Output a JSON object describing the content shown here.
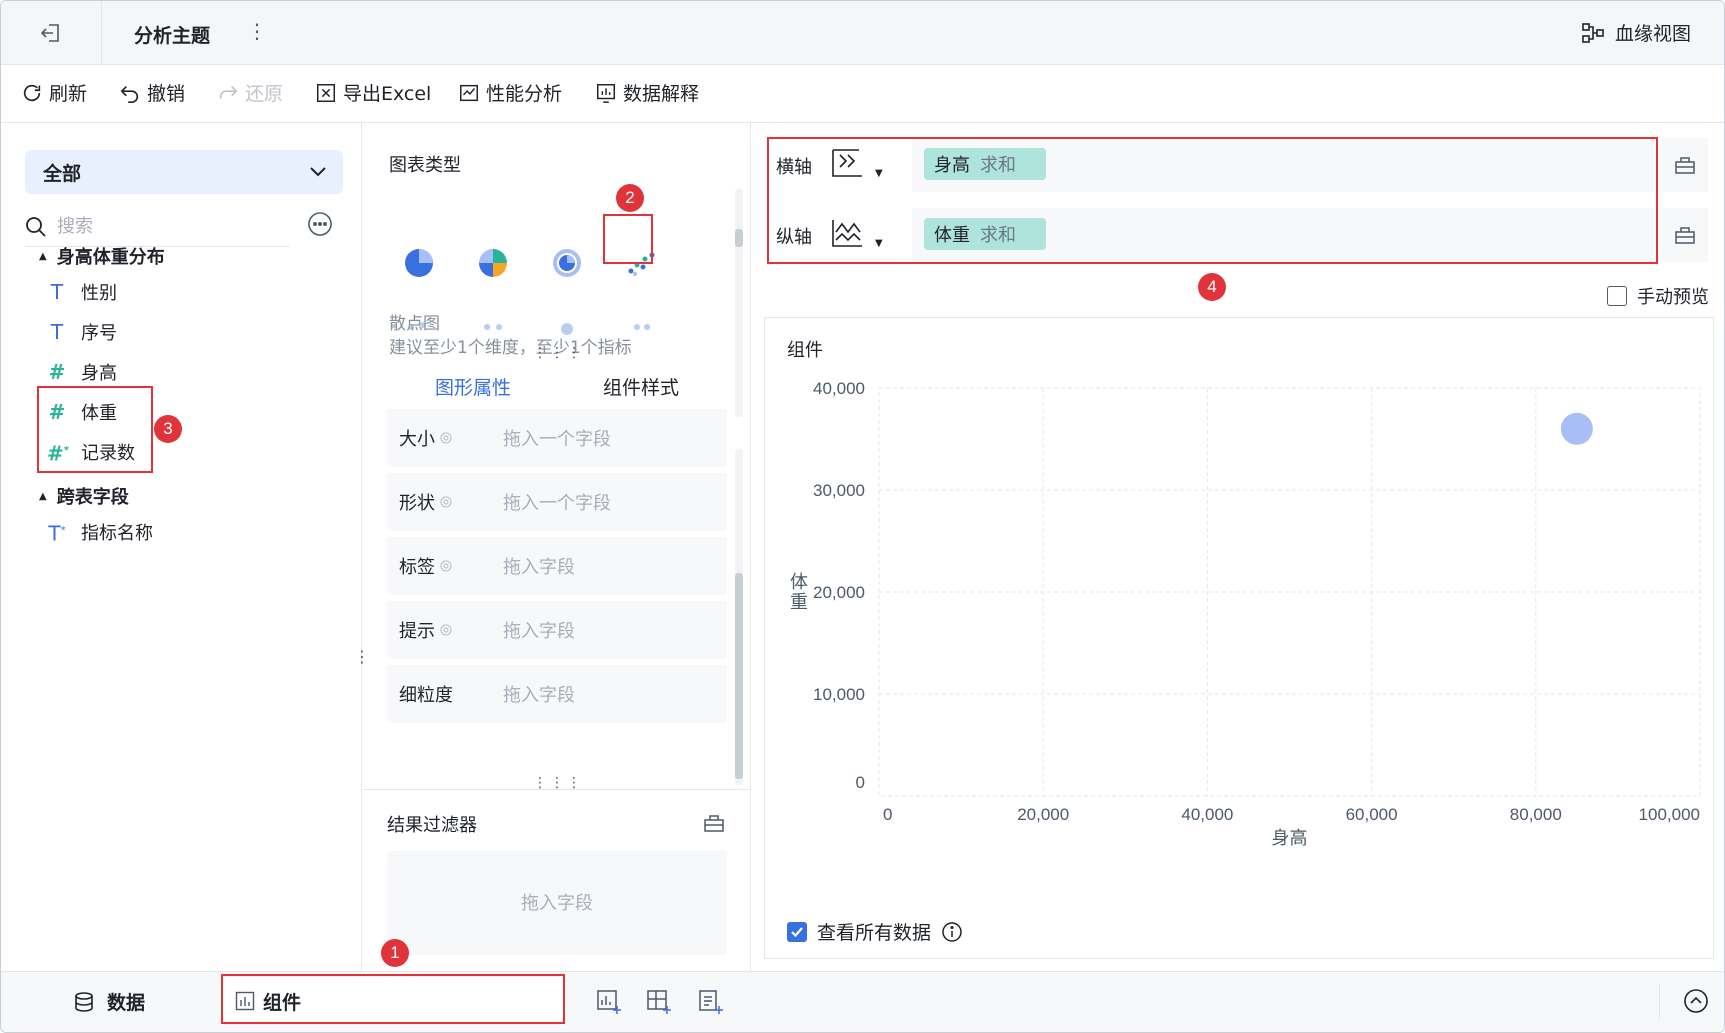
{
  "topbar": {
    "title": "分析主题",
    "more": "⋮",
    "lineage_label": "血缘视图"
  },
  "toolbar": {
    "refresh": "刷新",
    "undo": "撤销",
    "redo": "还原",
    "export": "导出Excel",
    "performance": "性能分析",
    "explain": "数据解释"
  },
  "left": {
    "scope": "全部",
    "search_placeholder": "搜索",
    "groups": [
      {
        "name": "身高体重分布",
        "fields": [
          {
            "type": "dimension",
            "name": "性别"
          },
          {
            "type": "dimension",
            "name": "序号"
          },
          {
            "type": "measure",
            "name": "身高"
          },
          {
            "type": "measure",
            "name": "体重"
          },
          {
            "type": "measure-calc",
            "name": "记录数"
          }
        ]
      },
      {
        "name": "跨表字段",
        "fields": [
          {
            "type": "dimension-calc",
            "name": "指标名称"
          }
        ]
      }
    ]
  },
  "middle": {
    "chart_type_title": "图表类型",
    "selected_chart_name": "散点图",
    "selected_chart_hint": "建议至少1个维度，至少1个指标",
    "tabs": [
      "图形属性",
      "组件样式"
    ],
    "properties": [
      {
        "label": "大小",
        "placeholder": "拖入一个字段"
      },
      {
        "label": "形状",
        "placeholder": "拖入一个字段"
      },
      {
        "label": "标签",
        "placeholder": "拖入字段"
      },
      {
        "label": "提示",
        "placeholder": "拖入字段"
      },
      {
        "label": "细粒度",
        "placeholder": "拖入字段"
      }
    ],
    "filter_title": "结果过滤器",
    "filter_placeholder": "拖入字段"
  },
  "right": {
    "x_axis": {
      "label": "横轴",
      "field": "身高",
      "agg": "求和"
    },
    "y_axis": {
      "label": "纵轴",
      "field": "体重",
      "agg": "求和"
    },
    "manual_preview": "手动预览",
    "widget_title": "组件",
    "view_all": "查看所有数据"
  },
  "chart_data": {
    "type": "scatter",
    "xlabel": "身高",
    "ylabel": "体重",
    "xlim": [
      0,
      100000
    ],
    "ylim": [
      0,
      40000
    ],
    "x_ticks": [
      "0",
      "20,000",
      "40,000",
      "60,000",
      "80,000",
      "100,000"
    ],
    "y_ticks": [
      "0",
      "10,000",
      "20,000",
      "30,000",
      "40,000"
    ],
    "points": [
      {
        "x": 85000,
        "y": 36000
      }
    ],
    "grid": true,
    "point_color": "#a7bff5"
  },
  "bottom": {
    "data_tab": "数据",
    "widget_tab": "组件"
  },
  "callouts": [
    "1",
    "2",
    "3",
    "4"
  ],
  "colors": {
    "accent": "#3870e0",
    "callout": "#e0343a",
    "measure": "#2bb39a",
    "pill": "#aee4db"
  }
}
